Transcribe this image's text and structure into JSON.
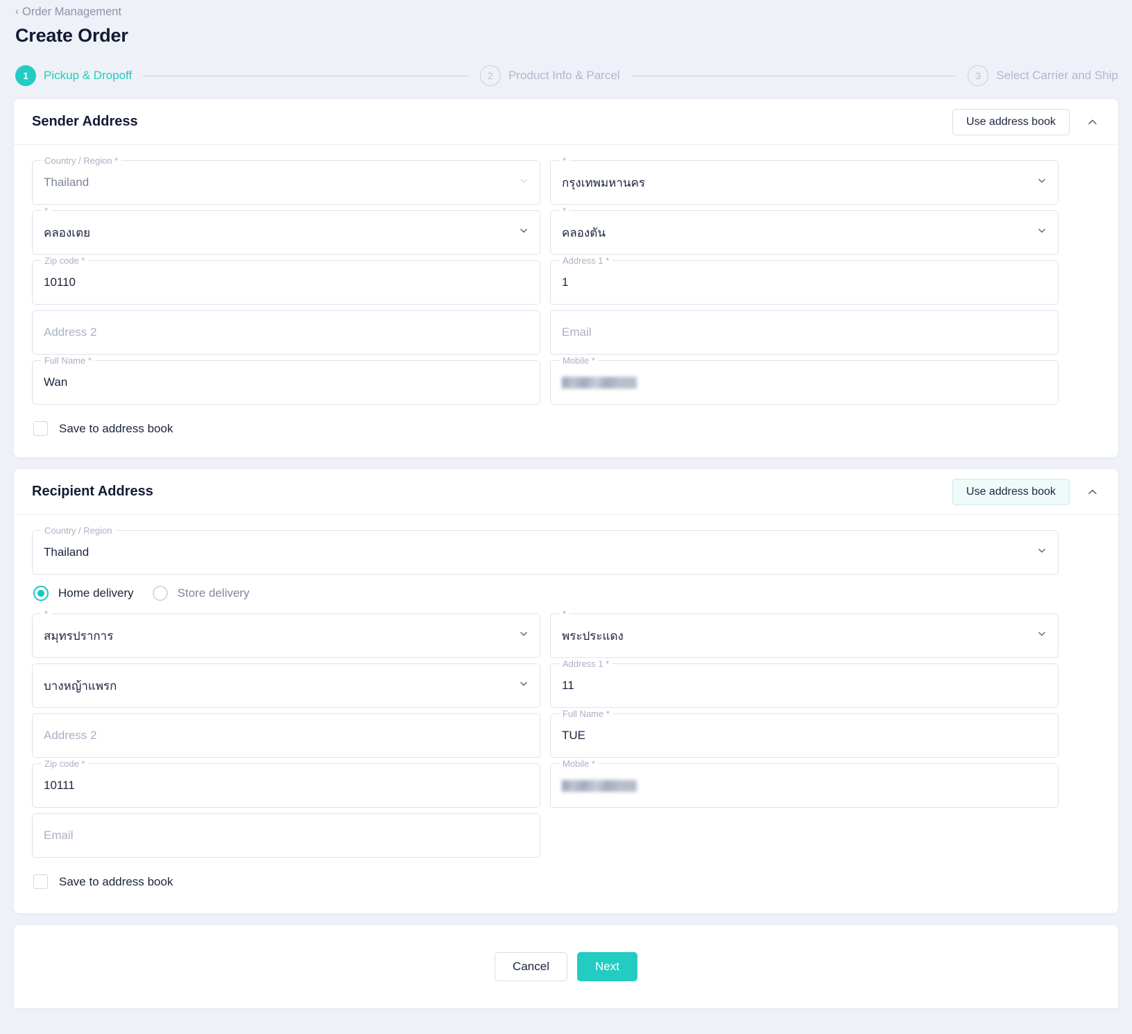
{
  "header": {
    "breadcrumb": "Order Management",
    "back_icon": "chevron-left-icon",
    "title": "Create Order"
  },
  "stepper": {
    "steps": [
      {
        "number": "1",
        "label": "Pickup & Dropoff",
        "state": "active"
      },
      {
        "number": "2",
        "label": "Product Info & Parcel",
        "state": "idle"
      },
      {
        "number": "3",
        "label": "Select Carrier and Ship",
        "state": "idle"
      }
    ]
  },
  "colors": {
    "accent": "#22ccc3",
    "page_bg": "#eef1f7",
    "card_bg": "#ffffff",
    "text": "#131a33",
    "muted": "#a9b1c3",
    "border": "#dde3ec"
  },
  "sender": {
    "title": "Sender Address",
    "address_book_label": "Use address book",
    "collapse_icon": "chevron-up-icon",
    "fields": {
      "country": {
        "label": "Country / Region",
        "required": true,
        "value": "Thailand",
        "disabled": true,
        "caret": "chevron-down-icon"
      },
      "province": {
        "label": "",
        "required": true,
        "value": "กรุงเทพมหานคร",
        "caret": "chevron-down-icon"
      },
      "district": {
        "label": "",
        "required": true,
        "value": "คลองเตย",
        "caret": "chevron-down-icon"
      },
      "subdistrict": {
        "label": "",
        "required": true,
        "value": "คลองตัน",
        "caret": "chevron-down-icon"
      },
      "zip": {
        "label": "Zip code",
        "required": true,
        "value": "10110"
      },
      "address1": {
        "label": "Address 1",
        "required": true,
        "value": "1"
      },
      "address2": {
        "label": "",
        "required": false,
        "value": "",
        "placeholder": "Address 2"
      },
      "email": {
        "label": "",
        "required": false,
        "value": "",
        "placeholder": "Email"
      },
      "fullname": {
        "label": "Full Name",
        "required": true,
        "value": "Wan"
      },
      "mobile": {
        "label": "Mobile",
        "required": true,
        "value": "",
        "redacted": true
      }
    },
    "save_checkbox": {
      "label": "Save to address book",
      "checked": false
    }
  },
  "recipient": {
    "title": "Recipient Address",
    "address_book_label": "Use address book",
    "address_book_hovered": true,
    "collapse_icon": "chevron-up-icon",
    "country": {
      "label": "Country / Region",
      "required": false,
      "value": "Thailand",
      "caret": "chevron-down-icon"
    },
    "delivery_options": [
      {
        "label": "Home delivery",
        "selected": true
      },
      {
        "label": "Store delivery",
        "selected": false
      }
    ],
    "fields": {
      "province": {
        "label": "",
        "required": true,
        "value": "สมุทรปราการ",
        "caret": "chevron-down-icon"
      },
      "district": {
        "label": "",
        "required": true,
        "value": "พระประแดง",
        "caret": "chevron-down-icon"
      },
      "subdistrict": {
        "label": "",
        "required": false,
        "value": "บางหญ้าแพรก",
        "caret": "chevron-down-icon"
      },
      "address1": {
        "label": "Address 1",
        "required": true,
        "value": "11"
      },
      "address2": {
        "label": "",
        "required": false,
        "value": "",
        "placeholder": "Address 2"
      },
      "fullname": {
        "label": "Full Name",
        "required": true,
        "value": "TUE"
      },
      "zip": {
        "label": "Zip code",
        "required": true,
        "value": "10111"
      },
      "mobile": {
        "label": "Mobile",
        "required": true,
        "value": "",
        "redacted": true
      },
      "email": {
        "label": "",
        "required": false,
        "value": "",
        "placeholder": "Email"
      }
    },
    "save_checkbox": {
      "label": "Save to address book",
      "checked": false
    }
  },
  "footer": {
    "cancel_label": "Cancel",
    "next_label": "Next"
  }
}
